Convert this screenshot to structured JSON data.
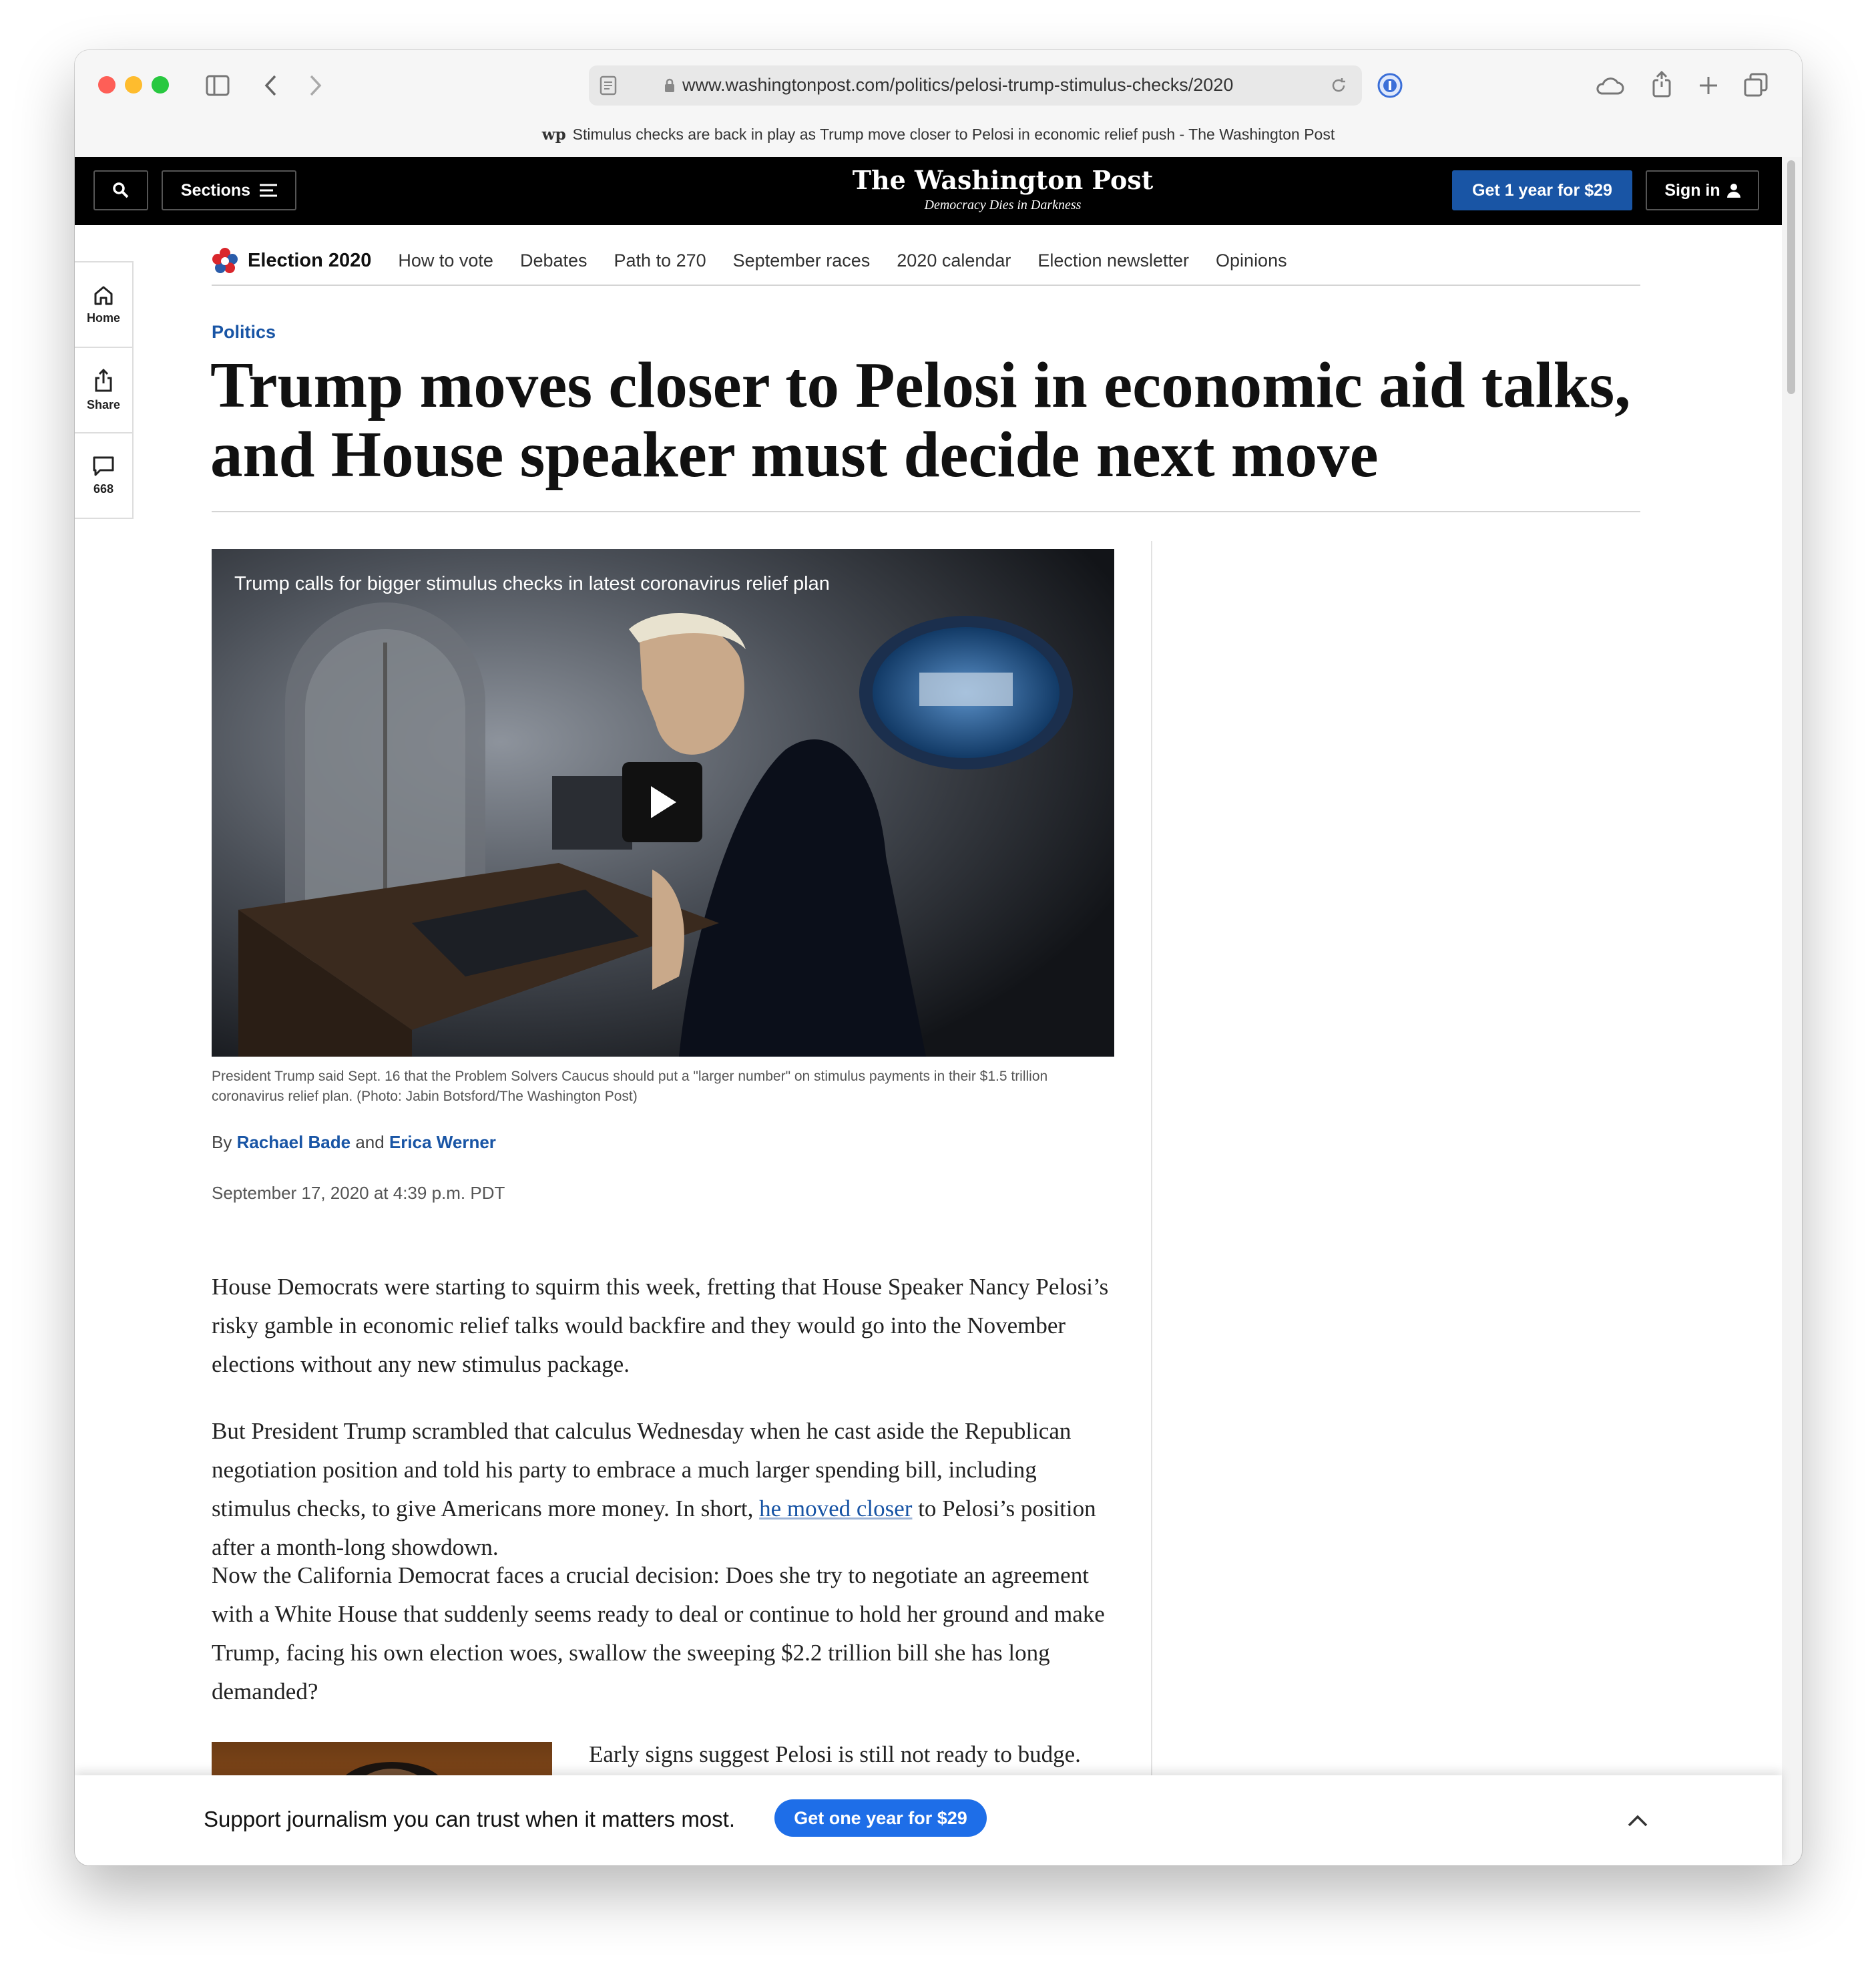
{
  "browser": {
    "url": "www.washingtonpost.com/politics/pelosi-trump-stimulus-checks/2020",
    "tab_title": "Stimulus checks are back in play as Trump move closer to Pelosi in economic relief push - The Washington Post",
    "tab_logo": "wp"
  },
  "header": {
    "sections_label": "Sections",
    "logo_name": "The Washington Post",
    "logo_tagline": "Democracy Dies in Darkness",
    "subscribe_label": "Get 1 year for $29",
    "signin_label": "Sign in"
  },
  "election_nav": {
    "title": "Election 2020",
    "items": [
      {
        "label": "How to vote"
      },
      {
        "label": "Debates"
      },
      {
        "label": "Path to 270"
      },
      {
        "label": "September races"
      },
      {
        "label": "2020 calendar"
      },
      {
        "label": "Election newsletter"
      },
      {
        "label": "Opinions"
      }
    ]
  },
  "side_rail": {
    "home_label": "Home",
    "share_label": "Share",
    "comments_count": "668"
  },
  "article": {
    "kicker": "Politics",
    "headline": "Trump moves closer to Pelosi in economic aid talks, and House speaker must decide next move",
    "video_title": "Trump calls for bigger stimulus checks in latest coronavirus relief plan",
    "caption": "President Trump said Sept. 16 that the Problem Solvers Caucus should put a \"larger number\" on stimulus payments in their $1.5 trillion coronavirus relief plan. (Photo: Jabin Botsford/The Washington Post)",
    "byline_prefix": "By",
    "author1": "Rachael Bade",
    "byline_and": "and",
    "author2": "Erica Werner",
    "date": "September 17, 2020 at 4:39 p.m. PDT",
    "para1": "House Democrats were starting to squirm this week, fretting that House Speaker Nancy Pelosi’s risky gamble in economic relief talks would backfire and they would go into the November elections without any new stimulus package.",
    "para2_before": "But President Trump scrambled that calculus Wednesday when he cast aside the Republican negotiation position and told his party to embrace a much larger spending bill, including stimulus checks, to give Americans more money. In short,",
    "para2_link": "he moved closer",
    "para2_after": "to Pelosi’s position after a month-long showdown.",
    "para3": "Now the California Democrat faces a crucial decision: Does she try to negotiate an agreement with a White House that suddenly seems ready to deal or continue to hold her ground and make Trump, facing his own election woes, swallow the sweeping $2.2 trillion bill she has long demanded?",
    "para4_start": "Early signs suggest Pelosi is still not ready to budge."
  },
  "banner": {
    "text": "Support journalism you can trust when it matters most.",
    "button": "Get one year for $29"
  },
  "colors": {
    "accent_blue": "#1955a5",
    "banner_button": "#1e6ee8",
    "header_bg": "#000000"
  }
}
